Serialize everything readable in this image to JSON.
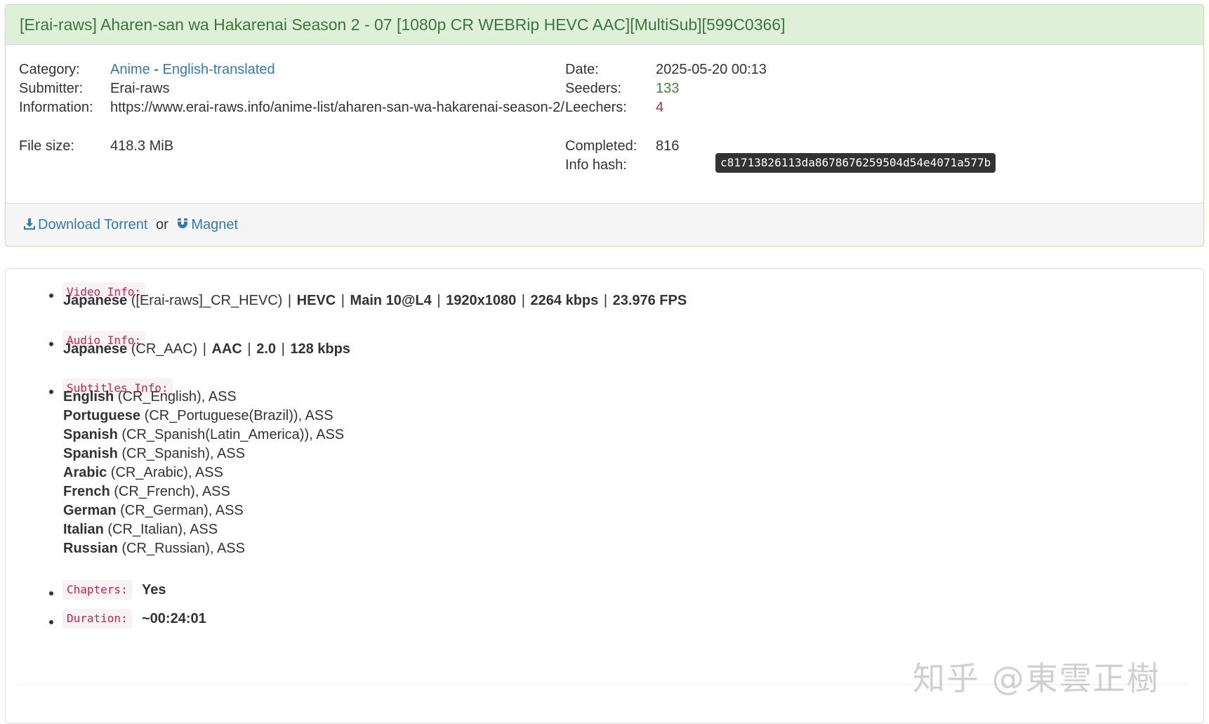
{
  "title": "[Erai-raws] Aharen-san wa Hakarenai Season 2 - 07 [1080p CR WEBRip HEVC AAC][MultiSub][599C0366]",
  "details": {
    "category_label": "Category:",
    "category_main": "Anime",
    "category_sep": " - ",
    "category_sub": "English-translated",
    "submitter_label": "Submitter:",
    "submitter": "Erai-raws",
    "information_label": "Information:",
    "information_url": "https://www.erai-raws.info/anime-list/aharen-san-wa-hakarenai-season-2/",
    "filesize_label": "File size:",
    "filesize": "418.3 MiB",
    "date_label": "Date:",
    "date": "2025-05-20 00:13",
    "seeders_label": "Seeders:",
    "seeders": "133",
    "leechers_label": "Leechers:",
    "leechers": "4",
    "completed_label": "Completed:",
    "completed": "816",
    "infohash_label": "Info hash:",
    "infohash": "c81713826113da8678676259504d54e4071a577b"
  },
  "footer": {
    "download_label": "Download Torrent",
    "or": "or",
    "magnet_label": "Magnet"
  },
  "description": {
    "video_tag": "Video Info:",
    "video": {
      "lang": "Japanese",
      "source": " ([Erai-raws]_CR_HEVC) ",
      "codec": "HEVC",
      "profile": "Main 10@L4",
      "resolution": "1920x1080",
      "bitrate": "2264 kbps",
      "fps": "23.976 FPS"
    },
    "audio_tag": "Audio Info:",
    "audio": {
      "lang": "Japanese",
      "source": " (CR_AAC) ",
      "codec": "AAC",
      "channels": "2.0",
      "bitrate": "128 kbps"
    },
    "subtitles_tag": "Subtitles Info:",
    "subtitles": [
      {
        "lang": "English",
        "rest": " (CR_English), ASS"
      },
      {
        "lang": "Portuguese",
        "rest": " (CR_Portuguese(Brazil)), ASS"
      },
      {
        "lang": "Spanish",
        "rest": " (CR_Spanish(Latin_America)), ASS"
      },
      {
        "lang": "Spanish",
        "rest": " (CR_Spanish), ASS"
      },
      {
        "lang": "Arabic",
        "rest": " (CR_Arabic), ASS"
      },
      {
        "lang": "French",
        "rest": " (CR_French), ASS"
      },
      {
        "lang": "German",
        "rest": " (CR_German), ASS"
      },
      {
        "lang": "Italian",
        "rest": " (CR_Italian), ASS"
      },
      {
        "lang": "Russian",
        "rest": " (CR_Russian), ASS"
      }
    ],
    "chapters_tag": "Chapters:",
    "chapters": "Yes",
    "duration_tag": "Duration:",
    "duration": "~00:24:01",
    "pipe": "|"
  },
  "watermark": "知乎 @東雲正樹",
  "colors": {
    "heading_bg": "#dff0d8",
    "heading_text": "#3c763d",
    "link": "#337ab7",
    "seeders": "#3c8c3c",
    "leechers": "#c9302c",
    "code": "#c7254e"
  }
}
